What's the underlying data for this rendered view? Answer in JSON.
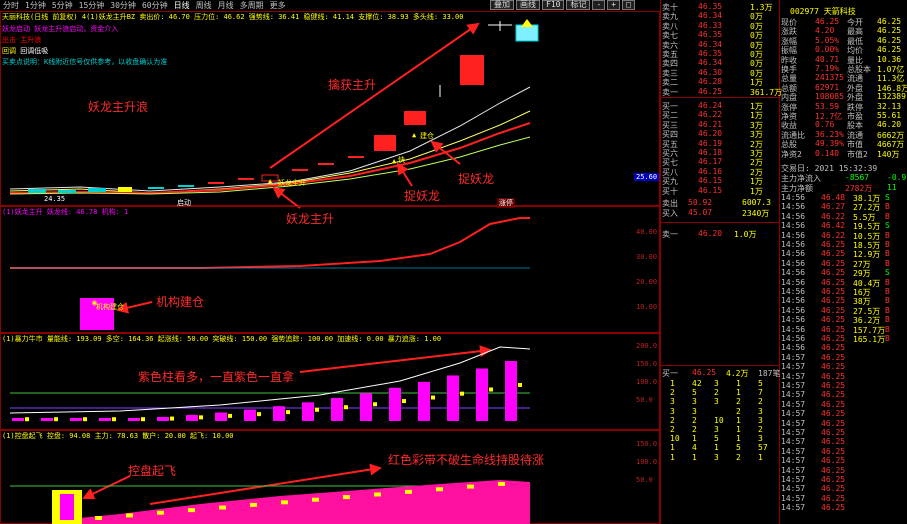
{
  "toolbar": {
    "items": [
      "分时",
      "1分钟",
      "5分钟",
      "15分钟",
      "30分钟",
      "60分钟",
      "日线",
      "周线",
      "月线",
      "多周期",
      "更多"
    ],
    "selected": "日线",
    "right_buttons": [
      "叠加",
      "画线",
      "F10",
      "标记",
      "-",
      "+",
      "□"
    ]
  },
  "main_header": "天丽科技(日线 前复权)  4(1)妖龙主升BZ  卖出价: 46.70  压力位: 46.62  强势线: 36.41  稳健线: 41.14  支撑位: 38.93  多头线: 33.00",
  "signal_legend": [
    {
      "label": "妖龙启动",
      "text": "妖龙主升浪启动，资金介入"
    },
    {
      "label": "出击",
      "text": "主升浪"
    },
    {
      "label": "回调",
      "text": "回调低吸"
    }
  ],
  "legend_line": "妖龙启动  出击  回调",
  "main_note_small": "买卖点说明：K线附近信号仅供参考，以收盘确认为准",
  "main_price_tags": {
    "low": "24.35",
    "high_tag": "25.60",
    "current": "33.00"
  },
  "annotations": {
    "main_left": "妖龙主升浪",
    "capture": "擒获主升",
    "catch1": "捉妖龙",
    "catch2": "捉妖龙",
    "main_bottom": "妖龙主升",
    "inst": "机构建仓",
    "purple": "紫色柱看多，一直紫色一直拿",
    "control": "控盘起飞",
    "red_band": "红色彩带不破生命线持股待涨"
  },
  "small_marks": {
    "start": "启动",
    "fast": "快",
    "buy": "建仓",
    "qidong": "妖龙主升",
    "tag2": "涨停"
  },
  "ind1": {
    "header": "(1)妖龙主升  妖龙线: 46.78  机构: 1",
    "ticks": [
      "40.00",
      "30.00",
      "20.00",
      "10.00"
    ],
    "box_label": "机构建仓"
  },
  "ind2": {
    "header": "(1)暴力牛市  量能线: 193.09  多空: 164.36  起涨线: 50.00  突破线: 150.00  强势追踪: 100.00  加速线: 0.00  暴力追涨: 1.00",
    "ticks": [
      "200.0",
      "150.0",
      "100.0",
      "50.0"
    ]
  },
  "ind3": {
    "header": "(1)控盘起飞  控盘: 94.08  主力: 78.63  散户: 20.00  起飞: 10.00",
    "ticks": [
      "150.0",
      "100.0",
      "50.0"
    ]
  },
  "quote": {
    "code_title": "002977 天箭科技",
    "asks": [
      {
        "name": "卖十",
        "price": "46.35",
        "vol": "1.3万"
      },
      {
        "name": "卖九",
        "price": "46.34",
        "vol": "0万"
      },
      {
        "name": "卖八",
        "price": "46.33",
        "vol": "0万"
      },
      {
        "name": "卖七",
        "price": "46.35",
        "vol": "0万"
      },
      {
        "name": "卖六",
        "price": "46.34",
        "vol": "0万"
      },
      {
        "name": "卖五",
        "price": "46.35",
        "vol": "0万"
      },
      {
        "name": "卖四",
        "price": "46.34",
        "vol": "0万"
      },
      {
        "name": "卖三",
        "price": "46.30",
        "vol": "0万"
      },
      {
        "name": "卖二",
        "price": "46.28",
        "vol": "1万"
      },
      {
        "name": "卖一",
        "price": "46.25",
        "vol": "361.7万"
      }
    ],
    "bids": [
      {
        "name": "买一",
        "price": "46.24",
        "vol": "1万"
      },
      {
        "name": "买二",
        "price": "46.22",
        "vol": "1万"
      },
      {
        "name": "买三",
        "price": "46.21",
        "vol": "3万"
      },
      {
        "name": "买四",
        "price": "46.20",
        "vol": "3万"
      },
      {
        "name": "买五",
        "price": "46.19",
        "vol": "2万"
      },
      {
        "name": "买六",
        "price": "46.18",
        "vol": "3万"
      },
      {
        "name": "买七",
        "price": "46.17",
        "vol": "2万"
      },
      {
        "name": "买八",
        "price": "46.16",
        "vol": "2万"
      },
      {
        "name": "买九",
        "price": "46.15",
        "vol": "1万"
      },
      {
        "name": "买十",
        "price": "46.15",
        "vol": "1万"
      }
    ],
    "stats": [
      {
        "k": "现价",
        "v": "46.25",
        "k2": "今开",
        "v2": "46.25"
      },
      {
        "k": "涨跌",
        "v": "4.20",
        "k2": "最高",
        "v2": "46.25"
      },
      {
        "k": "涨幅",
        "v": "5.05%",
        "k2": "最低",
        "v2": "46.25"
      },
      {
        "k": "振幅",
        "v": "0.00%",
        "k2": "均价",
        "v2": "46.25"
      },
      {
        "k": "昨收",
        "v": "40.71",
        "k2": "量比",
        "v2": "10.36"
      },
      {
        "k": "换手",
        "v": "7.19%",
        "k2": "总股本",
        "v2": "1.07亿"
      },
      {
        "k": "总量",
        "v": "241375",
        "k2": "流通",
        "v2": "11.3亿"
      },
      {
        "k": "总额",
        "v": "62971",
        "k2": "外盘",
        "v2": "146.8万"
      },
      {
        "k": "内盘",
        "v": "108085",
        "k2": "外盘",
        "v2": "132389"
      },
      {
        "k": "涨停",
        "v": "53.59",
        "k2": "跌停",
        "v2": "32.13"
      },
      {
        "k": "净资",
        "v": "12.7亿",
        "k2": "市盈",
        "v2": "55.61"
      },
      {
        "k": "收益",
        "v": "0.76",
        "k2": "股本",
        "v2": "46.20"
      },
      {
        "k": "流通比",
        "v": "36.23%",
        "k2": "流通",
        "v2": "6662万"
      },
      {
        "k": "总股",
        "v": "49.39%",
        "k2": "市值",
        "v2": "4667万"
      },
      {
        "k": "净资2",
        "v": "0.140",
        "k2": "市值2",
        "v2": "140万"
      }
    ],
    "flow_title": "交易日: 2021 15:32:39",
    "flow_rows": [
      {
        "k": "主力净流入",
        "v1": "-8567",
        "v2": "-0.9"
      },
      {
        "k": "主力净额",
        "v1": "2782万",
        "v2": "11"
      }
    ],
    "mid_box": {
      "l1": "46.20",
      "l2": "1.0万",
      "sell": "卖出",
      "buy": "买入",
      "sv": "50.92",
      "bv": "45.07",
      "sq": "6007.3",
      "bq": "2340万",
      "line": "卖一"
    },
    "order_queue": {
      "head": {
        "name": "买一",
        "price": "46.25",
        "vol": "4.2万",
        "n": "187笔"
      },
      "rows": [
        [
          "1",
          "42",
          "3",
          "1",
          "5"
        ],
        [
          "2",
          "5",
          "2",
          "1",
          "7"
        ],
        [
          "3",
          "3",
          "3",
          "2",
          "2"
        ],
        [
          "3",
          "3",
          "",
          "2",
          "3"
        ],
        [
          "2",
          "2",
          "10",
          "1",
          "3"
        ],
        [
          "2",
          "2",
          "3",
          "1",
          "2"
        ],
        [
          "10",
          "1",
          "5",
          "1",
          "3"
        ],
        [
          "1",
          "4",
          "1",
          "5",
          "57"
        ],
        [
          "1",
          "1",
          "3",
          "2",
          "1"
        ]
      ]
    },
    "ticks": [
      {
        "t": "14:56",
        "p": "46.48",
        "v": "38.1万",
        "f": "S"
      },
      {
        "t": "14:56",
        "p": "46.27",
        "v": "27.2万",
        "f": "B"
      },
      {
        "t": "14:56",
        "p": "46.22",
        "v": "5.5万",
        "f": "B"
      },
      {
        "t": "14:56",
        "p": "46.42",
        "v": "19.5万",
        "f": "S"
      },
      {
        "t": "14:56",
        "p": "46.22",
        "v": "10.5万",
        "f": "B"
      },
      {
        "t": "14:56",
        "p": "46.25",
        "v": "18.5万",
        "f": "B"
      },
      {
        "t": "14:56",
        "p": "46.25",
        "v": "12.9万",
        "f": "B"
      },
      {
        "t": "14:56",
        "p": "46.25",
        "v": "27万",
        "f": "B"
      },
      {
        "t": "14:56",
        "p": "46.25",
        "v": "29万",
        "f": "S"
      },
      {
        "t": "14:56",
        "p": "46.25",
        "v": "40.4万",
        "f": "B"
      },
      {
        "t": "14:56",
        "p": "46.25",
        "v": "16万",
        "f": "B"
      },
      {
        "t": "14:56",
        "p": "46.25",
        "v": "38万",
        "f": "B"
      },
      {
        "t": "14:56",
        "p": "46.25",
        "v": "27.5万",
        "f": "B"
      },
      {
        "t": "14:56",
        "p": "46.25",
        "v": "36.2万",
        "f": "B"
      },
      {
        "t": "14:56",
        "p": "46.25",
        "v": "157.7万",
        "f": "B"
      },
      {
        "t": "14:56",
        "p": "46.25",
        "v": "165.1万",
        "f": "B"
      },
      {
        "t": "14:56",
        "p": "46.25",
        "v": "",
        "f": ""
      },
      {
        "t": "14:57",
        "p": "46.25",
        "v": "",
        "f": ""
      },
      {
        "t": "14:57",
        "p": "46.25",
        "v": "",
        "f": ""
      },
      {
        "t": "14:57",
        "p": "46.25",
        "v": "",
        "f": ""
      },
      {
        "t": "14:57",
        "p": "46.25",
        "v": "",
        "f": ""
      },
      {
        "t": "14:57",
        "p": "46.25",
        "v": "",
        "f": ""
      },
      {
        "t": "14:57",
        "p": "46.25",
        "v": "",
        "f": ""
      },
      {
        "t": "14:57",
        "p": "46.25",
        "v": "",
        "f": ""
      },
      {
        "t": "14:57",
        "p": "46.25",
        "v": "",
        "f": ""
      },
      {
        "t": "14:57",
        "p": "46.25",
        "v": "",
        "f": ""
      },
      {
        "t": "14:57",
        "p": "46.25",
        "v": "",
        "f": ""
      },
      {
        "t": "14:57",
        "p": "46.25",
        "v": "",
        "f": ""
      },
      {
        "t": "14:57",
        "p": "46.25",
        "v": "",
        "f": ""
      },
      {
        "t": "14:57",
        "p": "46.25",
        "v": "",
        "f": ""
      },
      {
        "t": "14:57",
        "p": "46.25",
        "v": "",
        "f": ""
      },
      {
        "t": "14:57",
        "p": "46.25",
        "v": "",
        "f": ""
      },
      {
        "t": "14:57",
        "p": "46.25",
        "v": "",
        "f": ""
      },
      {
        "t": "14:57",
        "p": "46.25",
        "v": "",
        "f": ""
      }
    ]
  },
  "colors": {
    "up": "#ff2020",
    "down": "#00d0d0",
    "magenta": "#ff00ff",
    "yellow": "#ffff00",
    "frame": "#8a0000"
  }
}
